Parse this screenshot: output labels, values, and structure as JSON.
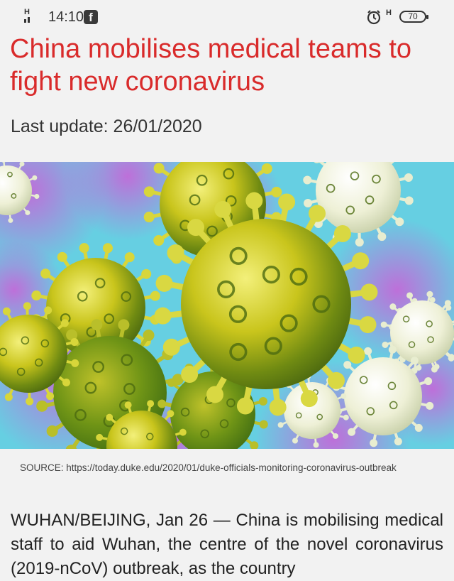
{
  "status_bar": {
    "signal_label": "H",
    "time": "14:10",
    "app_icon": "facebook-icon",
    "alarm_icon": "alarm-clock-icon",
    "network_label": "H",
    "battery": "70"
  },
  "article": {
    "headline": "China mobilises medical teams to fight new coronavirus",
    "last_update": "Last update: 26/01/2020",
    "image": "coronavirus-illustration",
    "source": "SOURCE: https://today.duke.edu/2020/01/duke-officials-monitoring-coronavirus-outbreak",
    "body": "WUHAN/BEIJING, Jan 26 — China is mobilising medical staff to aid Wuhan, the centre of the novel coronavirus (2019-nCoV) outbreak, as the country"
  },
  "colors": {
    "headline": "#d92b2b",
    "background": "#f2f2f2"
  }
}
